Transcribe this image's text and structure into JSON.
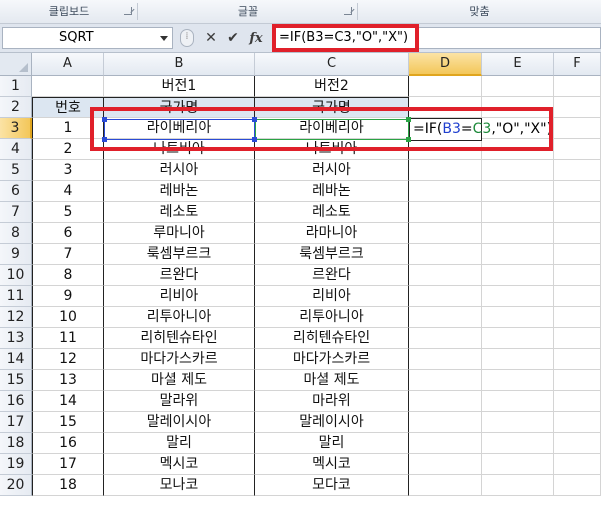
{
  "ribbon": {
    "groups": [
      {
        "label": "클립보드"
      },
      {
        "label": "글꼴"
      },
      {
        "label": "맞춤"
      }
    ]
  },
  "formula_bar": {
    "name_box": "SQRT",
    "cancel_glyph": "✕",
    "enter_glyph": "✔",
    "fx_glyph": "fx",
    "formula": "=IF(B3=C3,\"O\",\"X\")"
  },
  "columns": [
    "A",
    "B",
    "C",
    "D",
    "E",
    "F"
  ],
  "rows": [
    "1",
    "2",
    "3",
    "4",
    "5",
    "6",
    "7",
    "8",
    "9",
    "10",
    "11",
    "12",
    "13",
    "14",
    "15",
    "16",
    "17",
    "18",
    "19",
    "20"
  ],
  "sheet": {
    "b1": "버전1",
    "c1": "버전2",
    "a2": "번호",
    "b2": "국가명",
    "c2": "국가명",
    "data": [
      {
        "a": "1",
        "b": "라이베리아",
        "c": "라이베리아"
      },
      {
        "a": "2",
        "b": "나트비아",
        "c": "나트비아"
      },
      {
        "a": "3",
        "b": "러시아",
        "c": "러시아"
      },
      {
        "a": "4",
        "b": "레바논",
        "c": "레바논"
      },
      {
        "a": "5",
        "b": "레소토",
        "c": "레소토"
      },
      {
        "a": "6",
        "b": "루마니아",
        "c": "라마니아"
      },
      {
        "a": "7",
        "b": "룩셈부르크",
        "c": "룩셈부르크"
      },
      {
        "a": "8",
        "b": "르완다",
        "c": "르완다"
      },
      {
        "a": "9",
        "b": "리비아",
        "c": "리비아"
      },
      {
        "a": "10",
        "b": "리투아니아",
        "c": "리투아니아"
      },
      {
        "a": "11",
        "b": "리히텐슈타인",
        "c": "리히텐슈타인"
      },
      {
        "a": "12",
        "b": "마다가스카르",
        "c": "마다가스카르"
      },
      {
        "a": "13",
        "b": "마셜 제도",
        "c": "마셜 제도"
      },
      {
        "a": "14",
        "b": "말라위",
        "c": "마라위"
      },
      {
        "a": "15",
        "b": "말레이시아",
        "c": "말레이시아"
      },
      {
        "a": "16",
        "b": "말리",
        "c": "말리"
      },
      {
        "a": "17",
        "b": "멕시코",
        "c": "멕시코"
      },
      {
        "a": "18",
        "b": "모나코",
        "c": "모다코"
      }
    ]
  },
  "edit_cell": {
    "prefix": "=IF(",
    "ref1": "B3",
    "eq": "=",
    "ref2": "C3",
    "suffix": ",\"O\",\"X\")"
  },
  "colors": {
    "annotation": "#e0202a",
    "ref_b": "#1f3fcf",
    "ref_c": "#1d8a3a",
    "active_header": "#f3c75a",
    "header_fill": "#dce6f1"
  }
}
